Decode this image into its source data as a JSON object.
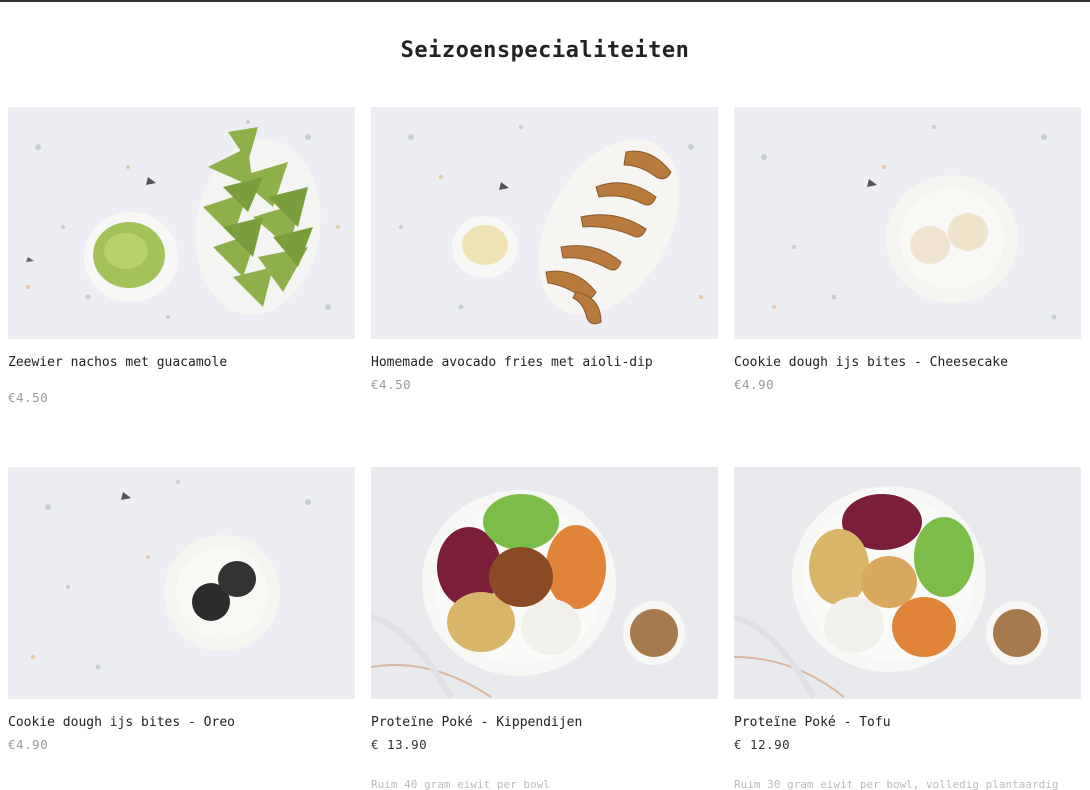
{
  "section": {
    "title": "Seizoenspecialiteiten"
  },
  "products": [
    {
      "name": "Zeewier nachos met guacamole",
      "price": "€4.50",
      "image": "nachos-guacamole-image"
    },
    {
      "name": "Homemade avocado fries met aioli-dip",
      "price": "€4.50",
      "image": "avocado-fries-image"
    },
    {
      "name": "Cookie dough ijs bites - Cheesecake",
      "price": "€4.90",
      "image": "cheesecake-bites-image"
    },
    {
      "name": "Cookie dough ijs bites - Oreo",
      "price": "€4.90",
      "image": "oreo-bites-image"
    },
    {
      "name": "Proteïne Poké - Kippendijen",
      "price": "€ 13.90",
      "image": "poke-chicken-image",
      "desc": "Ruim 40 gram eiwit per bowl"
    },
    {
      "name": "Proteïne Poké - Tofu",
      "price": "€ 12.90",
      "image": "poke-tofu-image",
      "desc": "Ruim 30 gram eiwit per bowl, volledig plantaardig"
    }
  ],
  "colors": {
    "terrazzo": "#eceef3",
    "marble": "#e9eaee",
    "text": "#222222",
    "price_muted": "#999999"
  }
}
